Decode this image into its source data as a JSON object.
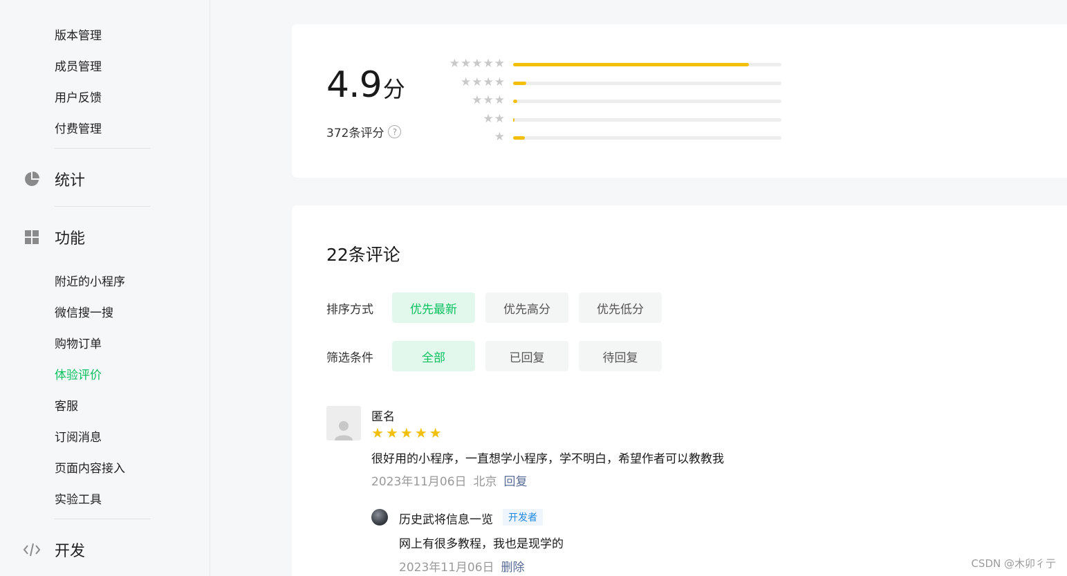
{
  "sidebar": {
    "top_items": [
      "版本管理",
      "成员管理",
      "用户反馈",
      "付费管理"
    ],
    "stats_label": "统计",
    "features_label": "功能",
    "feature_items": [
      "附近的小程序",
      "微信搜一搜",
      "购物订单",
      "体验评价",
      "客服",
      "订阅消息",
      "页面内容接入",
      "实验工具"
    ],
    "active_item": "体验评价",
    "dev_label": "开发"
  },
  "rating": {
    "score": "4.9",
    "score_unit": "分",
    "count_text": "372条评分",
    "help_icon": "question-circle-icon",
    "distribution": [
      {
        "stars": 5,
        "fraction": 0.88
      },
      {
        "stars": 4,
        "fraction": 0.05
      },
      {
        "stars": 3,
        "fraction": 0.015
      },
      {
        "stars": 2,
        "fraction": 0.005
      },
      {
        "stars": 1,
        "fraction": 0.045
      }
    ],
    "bar_color": "#f2c00a"
  },
  "comments": {
    "title": "22条评论",
    "sort_label": "排序方式",
    "sort_options": [
      "优先最新",
      "优先高分",
      "优先低分"
    ],
    "sort_selected": "优先最新",
    "filter_label": "筛选条件",
    "filter_options": [
      "全部",
      "已回复",
      "待回复"
    ],
    "filter_selected": "全部",
    "items": [
      {
        "name": "匿名",
        "stars": 5,
        "text": "很好用的小程序，一直想学小程序，学不明白，希望作者可以教教我",
        "date": "2023年11月06日",
        "location": "北京",
        "reply_action": "回复",
        "reply": {
          "name": "历史武将信息一览",
          "badge": "开发者",
          "text": "网上有很多教程，我也是现学的",
          "date": "2023年11月06日",
          "delete_action": "删除"
        }
      }
    ]
  },
  "watermark": "CSDN @木卯彳亍",
  "accent_color": "#07c160"
}
